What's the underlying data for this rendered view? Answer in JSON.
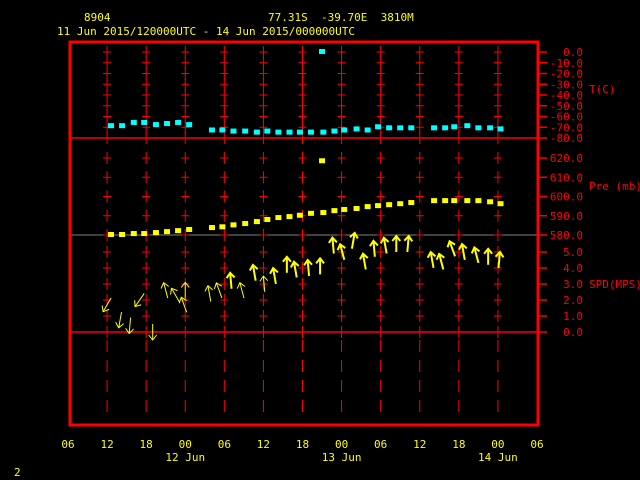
{
  "header": {
    "station_id": "8904",
    "location": "77.31S  -39.70E  3810M",
    "time_range": "11 Jun 2015/120000UTC - 14 Jun 2015/000000UTC"
  },
  "page_number": "2",
  "colors": {
    "frame": "#ff0000",
    "axis_text": "#ffff00",
    "temperature": "#00ffff",
    "pressure": "#ffff00",
    "wind": "#ffff00",
    "grid_divider": "#808080"
  },
  "chart_data": {
    "type": "scatter",
    "x_unit": "hours since 11 Jun 2015 12UTC",
    "xlim": [
      -6,
      66
    ],
    "x_tick_labels": [
      "06",
      "12",
      "18",
      "00",
      "06",
      "12",
      "18",
      "00",
      "06",
      "12",
      "18",
      "00",
      "06"
    ],
    "x_date_labels": [
      {
        "label": "12 Jun",
        "hour": 12
      },
      {
        "label": "13 Jun",
        "hour": 36
      },
      {
        "label": "14 Jun",
        "hour": 60
      }
    ],
    "panels": [
      {
        "name": "temperature",
        "label": "T(C)",
        "ylim": [
          -80,
          0
        ],
        "tick_labels": [
          "0.0",
          "-10.0",
          "-20.0",
          "-30.0",
          "-40.0",
          "-50.0",
          "-60.0",
          "-70.0",
          "-80.0"
        ],
        "tick_values": [
          0,
          -10,
          -20,
          -30,
          -40,
          -50,
          -60,
          -70,
          -80
        ],
        "series": [
          {
            "name": "T",
            "marker": "square",
            "x": [
              0.6,
              2.3,
              4.1,
              5.7,
              7.5,
              9.2,
              10.9,
              12.6,
              16.1,
              17.7,
              19.4,
              21.2,
              23.0,
              24.6,
              26.3,
              28.0,
              29.6,
              31.3,
              33.2,
              34.9,
              36.4,
              38.3,
              40.0,
              41.6,
              43.3,
              45.0,
              46.7,
              50.2,
              51.9,
              53.3,
              55.3,
              57.0,
              58.8,
              60.4,
              33.0
            ],
            "y": [
              -69,
              -69,
              -66,
              -66,
              -68,
              -67,
              -66,
              -68,
              -73,
              -73,
              -74,
              -74,
              -75,
              -74,
              -75,
              -75,
              -75,
              -75,
              -75,
              -74,
              -73,
              -72,
              -73,
              -70,
              -71,
              -71,
              -71,
              -71,
              -71,
              -70,
              -69,
              -71,
              -71,
              -72,
              0
            ]
          }
        ]
      },
      {
        "name": "pressure",
        "label": "Pre (mb)",
        "ylim": [
          580,
          620
        ],
        "tick_labels": [
          "620.0",
          "610.0",
          "600.0",
          "590.0",
          "580.0"
        ],
        "tick_values": [
          620,
          610,
          600,
          590,
          580
        ],
        "series": [
          {
            "name": "Pre",
            "marker": "square",
            "x": [
              0.6,
              2.3,
              4.1,
              5.7,
              7.5,
              9.2,
              10.9,
              12.6,
              16.1,
              17.7,
              19.4,
              21.2,
              23.0,
              24.6,
              26.3,
              28.0,
              29.6,
              31.3,
              33.2,
              34.9,
              36.4,
              38.3,
              40.0,
              41.6,
              43.3,
              45.0,
              46.7,
              50.2,
              51.9,
              53.3,
              55.3,
              57.0,
              58.8,
              60.4,
              33.0
            ],
            "y": [
              580,
              580,
              580.5,
              580.5,
              581,
              581.5,
              582,
              582.6,
              583.6,
              584,
              585,
              585.7,
              586.7,
              587.8,
              588.8,
              589.3,
              590,
              591,
              591.4,
              592.4,
              593,
              593.5,
              594.5,
              595,
              595.5,
              596,
              596.6,
              597.6,
              597.6,
              597.6,
              597.6,
              597.6,
              597,
              596,
              618.3
            ]
          }
        ]
      },
      {
        "name": "wind_speed",
        "label": "SPD(MPS)",
        "ylim": [
          0,
          5.5
        ],
        "tick_labels": [
          "5.0",
          "4.0",
          "3.0",
          "2.0",
          "1.0",
          "0.0"
        ],
        "tick_values": [
          5,
          4,
          3,
          2,
          1,
          0
        ],
        "series": [
          {
            "name": "wind",
            "marker": "arrow",
            "x": [
              0,
              2,
              3.5,
              5,
              7,
              9,
              10.5,
              12,
              11.8,
              15.7,
              17.2,
              19,
              20.7,
              22.6,
              24.1,
              25.7,
              27.6,
              28.9,
              30.9,
              32.7,
              34.7,
              36.1,
              37.8,
              39.5,
              41,
              42.7,
              44.4,
              46.2,
              49.9,
              51.3,
              53,
              54.7,
              56.7,
              58.5,
              60.2
            ],
            "y": [
              1.7,
              0.75,
              0.4,
              2.0,
              0.0,
              2.6,
              2.3,
              2.6,
              1.7,
              2.4,
              2.6,
              3.2,
              2.6,
              3.7,
              3.0,
              3.5,
              4.2,
              3.9,
              4.0,
              4.1,
              5.4,
              5.0,
              5.7,
              4.4,
              5.2,
              5.4,
              5.5,
              5.5,
              4.5,
              4.4,
              5.2,
              5.0,
              4.8,
              4.7,
              4.5
            ],
            "direction_deg": [
              210,
              190,
              185,
              215,
              180,
              345,
              330,
              0,
              340,
              350,
              340,
              355,
              345,
              350,
              355,
              350,
              0,
              350,
              355,
              0,
              355,
              345,
              10,
              350,
              355,
              350,
              0,
              5,
              350,
              345,
              340,
              350,
              345,
              0,
              5
            ]
          }
        ]
      }
    ]
  }
}
